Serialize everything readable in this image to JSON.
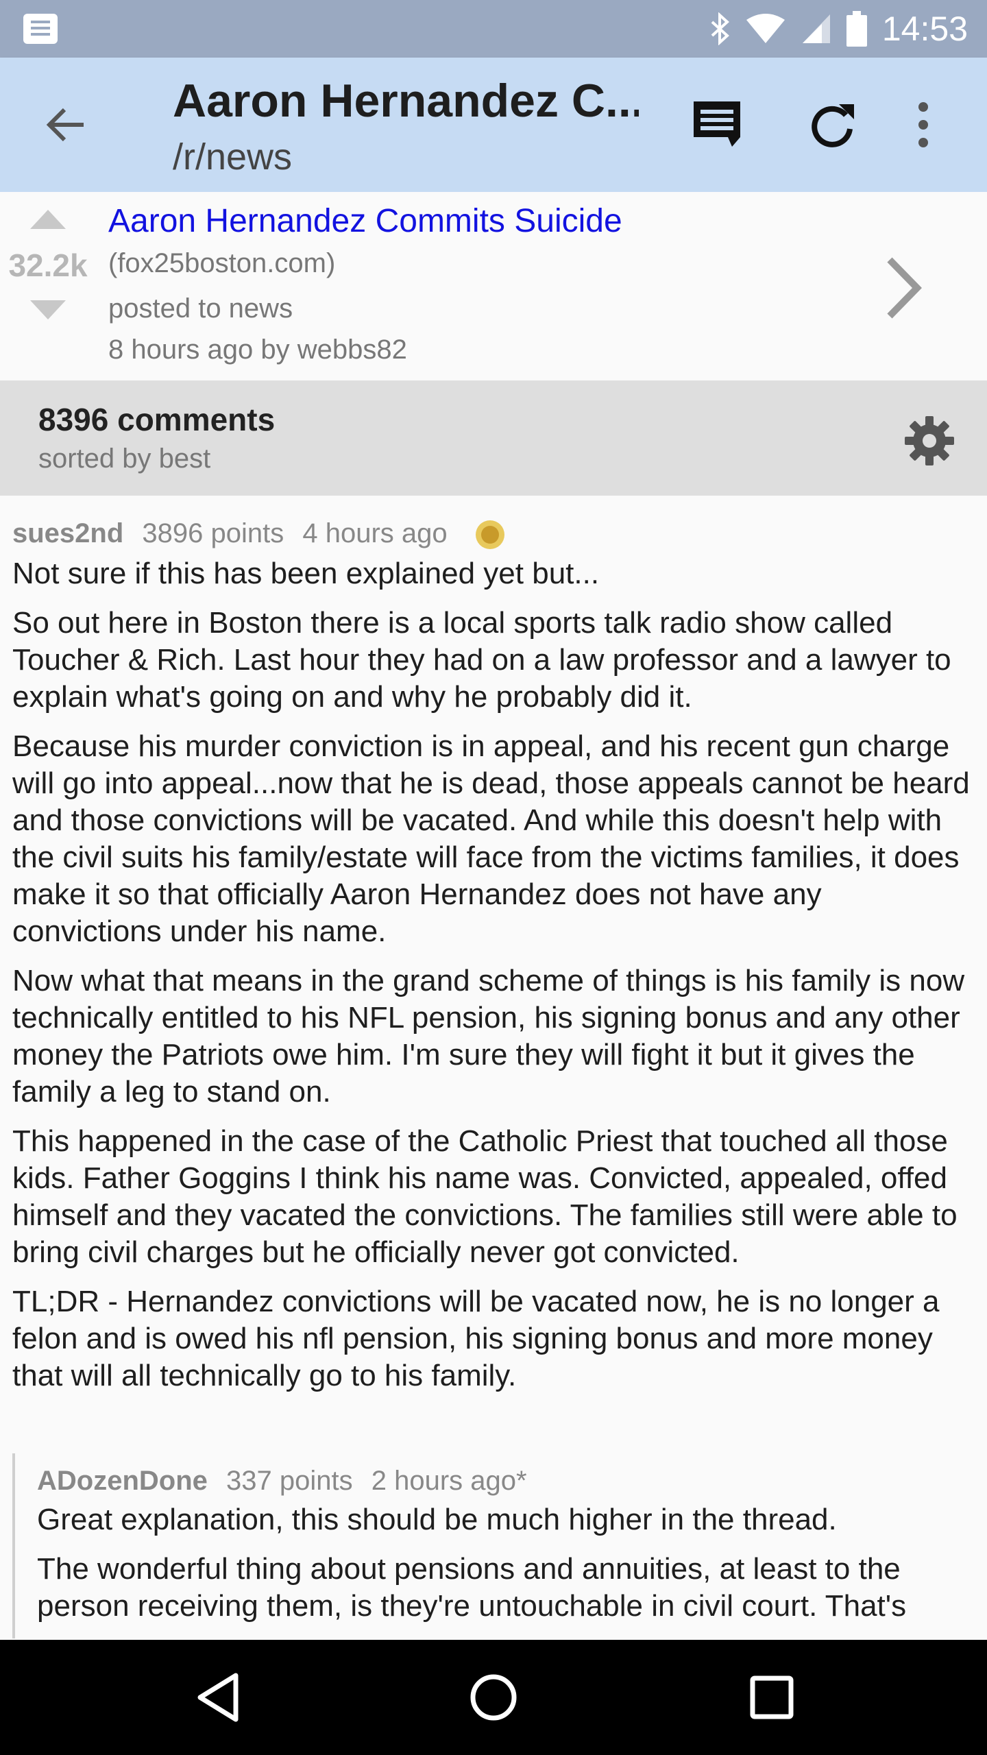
{
  "status_bar": {
    "time": "14:53",
    "icons": [
      "notification-icon",
      "bluetooth-icon",
      "wifi-icon",
      "signal-icon",
      "battery-icon"
    ]
  },
  "app_bar": {
    "title": "Aaron Hernandez C...",
    "subtitle": "/r/news",
    "icons": [
      "back-arrow-icon",
      "comments-icon",
      "refresh-icon",
      "more-vert-icon"
    ],
    "background": "#c6dbf3"
  },
  "post": {
    "score": "32.2k",
    "title": "Aaron Hernandez Commits Suicide",
    "domain": "(fox25boston.com)",
    "posted_to": "posted to news",
    "age": "8 hours ago",
    "author": "by webbs82",
    "title_color": "#1212e0"
  },
  "comments_header": {
    "count": "8396 comments",
    "sort": "sorted by best"
  },
  "comments": [
    {
      "author": "sues2nd",
      "points": "3896 points",
      "age": "4 hours ago",
      "gilded": true,
      "paragraphs": [
        "Not sure if this has been explained yet but...",
        "So out here in Boston there is a local sports talk radio show called Toucher & Rich. Last hour they had on a law professor and a lawyer to explain what's going on and why he probably did it.",
        "Because his murder conviction is in appeal, and his recent gun charge will go into appeal...now that he is dead, those appeals cannot be heard and those convictions will be vacated. And while this doesn't help with the civil suits his family/estate will face from the victims families, it does make it so that officially Aaron Hernandez does not have any convictions under his name.",
        "Now what that means in the grand scheme of things is his family is now technically entitled to his NFL pension, his signing bonus and any other money the Patriots owe him. I'm sure they will fight it but it gives the family a leg to stand on.",
        "This happened in the case of the Catholic Priest that touched all those kids. Father Goggins I think his name was. Convicted, appealed, offed himself and they vacated the convictions. The families still were able to bring civil charges but he officially never got convicted.",
        "TL;DR - Hernandez convictions will be vacated now, he is no longer a felon and is owed his nfl pension, his signing bonus and more money that will all technically go to his family."
      ]
    },
    {
      "author": "ADozenDone",
      "points": "337 points",
      "age": "2 hours ago*",
      "paragraphs": [
        "Great explanation, this should be much higher in the thread.",
        "The wonderful thing about pensions and annuities, at least to the person receiving them, is they're untouchable in civil court. That's"
      ]
    }
  ],
  "nav_bar": {
    "icons": [
      "back-triangle-icon",
      "home-circle-icon",
      "recents-square-icon"
    ]
  }
}
